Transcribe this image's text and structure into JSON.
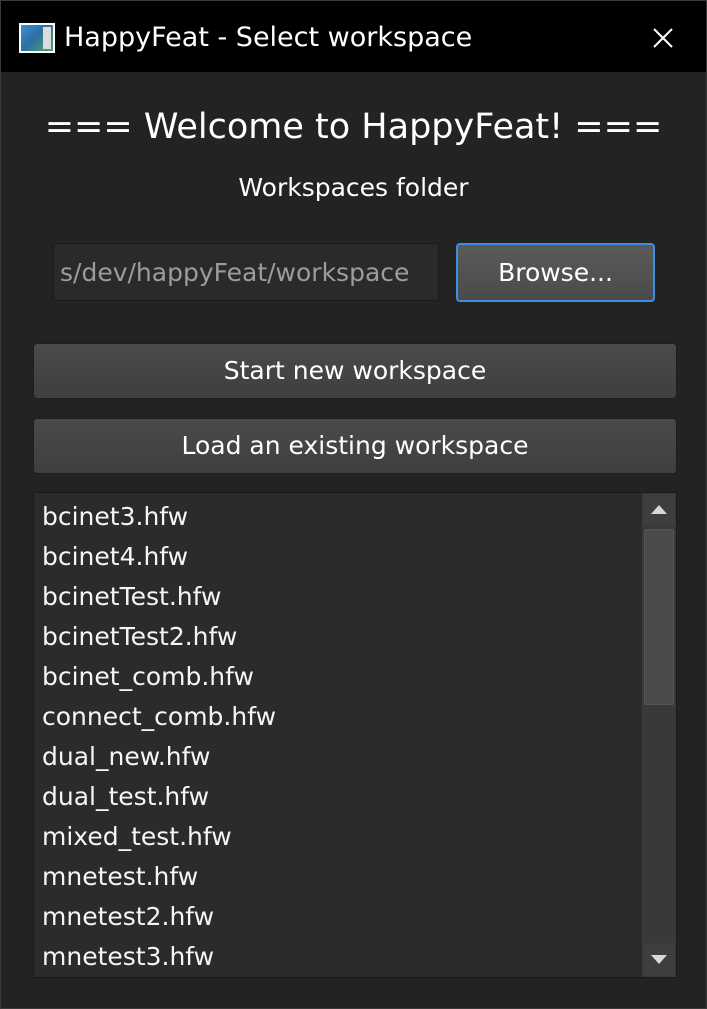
{
  "window": {
    "title": "HappyFeat - Select workspace",
    "close_icon": "close-icon"
  },
  "welcome": {
    "heading": "=== Welcome to HappyFeat! ===",
    "folder_label": "Workspaces folder"
  },
  "folder": {
    "path_value": "s/dev/happyFeat/workspace",
    "browse_label": "Browse..."
  },
  "actions": {
    "start_new_label": "Start new workspace",
    "load_existing_label": "Load an existing workspace"
  },
  "workspaces": {
    "items": [
      "bcinet3.hfw",
      "bcinet4.hfw",
      "bcinetTest.hfw",
      "bcinetTest2.hfw",
      "bcinet_comb.hfw",
      "connect_comb.hfw",
      "dual_new.hfw",
      "dual_test.hfw",
      "mixed_test.hfw",
      "mnetest.hfw",
      "mnetest2.hfw",
      "mnetest3.hfw"
    ]
  },
  "colors": {
    "accent": "#3d8ee6",
    "background": "#232323",
    "titlebar": "#000000"
  }
}
